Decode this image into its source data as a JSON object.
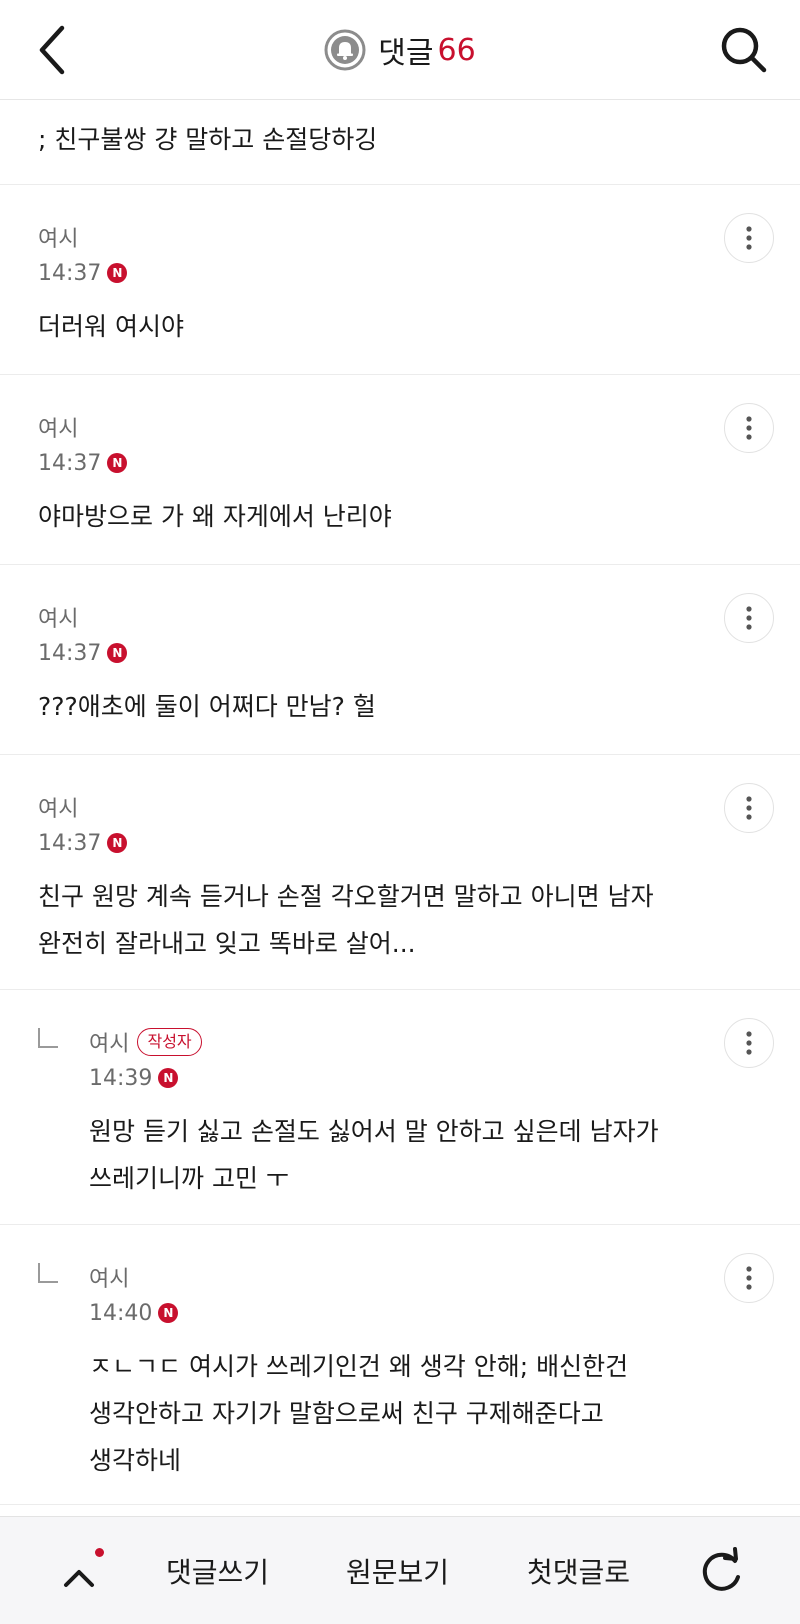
{
  "header": {
    "title": "댓글",
    "count": "66",
    "accent_color": "#c8102e",
    "icons": {
      "back": "back-chevron-icon",
      "bell": "bell-icon",
      "search": "search-icon"
    }
  },
  "top_snippet": "; 친구불쌍 걍 말하고 손절당하깅",
  "comments": [
    {
      "author": "여시",
      "time": "14:37",
      "new": "N",
      "text": "더러워 여시야"
    },
    {
      "author": "여시",
      "time": "14:37",
      "new": "N",
      "text": "야마방으로 가 왜 자게에서 난리야"
    },
    {
      "author": "여시",
      "time": "14:37",
      "new": "N",
      "text": "???애초에 둘이 어쩌다 만남? 헐"
    },
    {
      "author": "여시",
      "time": "14:37",
      "new": "N",
      "text_lines": [
        "친구 원망 계속 듣거나 손절 각오할거면 말하고 아니면 남자",
        "완전히 잘라내고 잊고 똑바로 살어..."
      ]
    },
    {
      "author": "여시",
      "badge": "작성자",
      "time": "14:39",
      "new": "N",
      "reply": true,
      "text_lines": [
        "원망 듣기 싫고 손절도 싫어서 말 안하고 싶은데 남자가",
        "쓰레기니까 고민 ㅜ"
      ]
    },
    {
      "author": "여시",
      "time": "14:40",
      "new": "N",
      "reply": true,
      "text_lines": [
        "ㅈㄴㄱㄷ 여시가 쓰레기인건 왜 생각 안해; 배신한건",
        "생각안하고 자기가 말함으로써 친구 구제해준다고",
        "생각하네"
      ]
    }
  ],
  "bottom_bar": {
    "write": "댓글쓰기",
    "original": "원문보기",
    "first": "첫댓글로",
    "icons": {
      "up": "chevron-up-icon",
      "refresh": "refresh-icon"
    }
  }
}
